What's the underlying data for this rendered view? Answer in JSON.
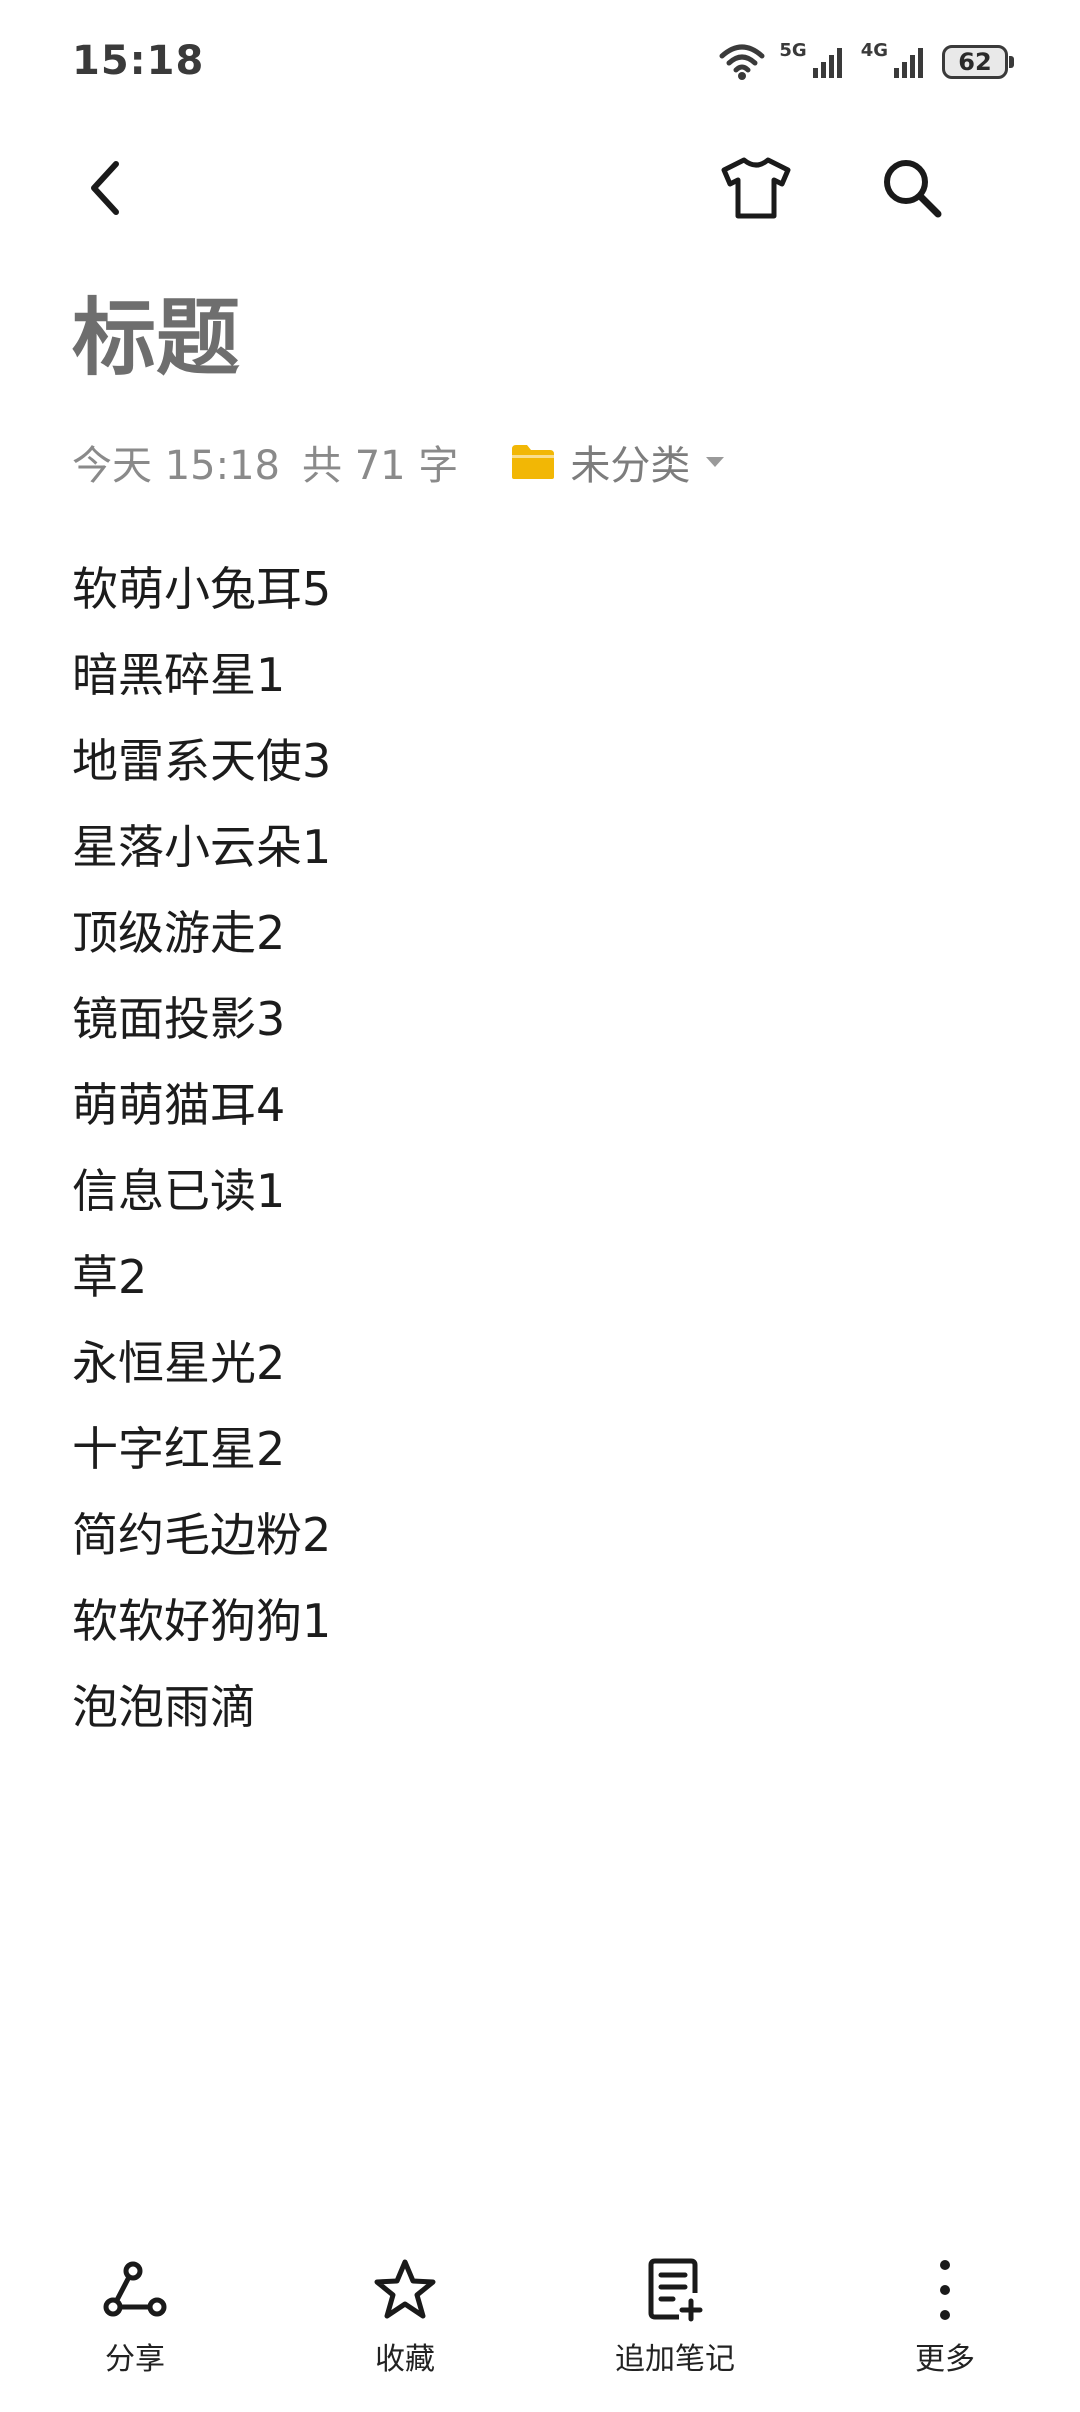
{
  "status_bar": {
    "time": "15:18",
    "net1": "5G",
    "net2": "4G",
    "battery": "62"
  },
  "icons": {
    "back": "chevron-left-icon",
    "theme": "shirt-icon",
    "search": "search-icon"
  },
  "note": {
    "title": "标题",
    "date": "今天 15:18",
    "word_count": "共 71 字",
    "folder": "未分类",
    "folder_color": "#F2B705",
    "lines": [
      "软萌小兔耳5",
      "暗黑碎星1",
      "地雷系天使3",
      "星落小云朵1",
      "顶级游走2",
      "镜面投影3",
      "萌萌猫耳4",
      "信息已读1",
      "草2",
      "永恒星光2",
      "十字红星2",
      "简约毛边粉2",
      "软软好狗狗1",
      "泡泡雨滴"
    ]
  },
  "toolbar": {
    "share": "分享",
    "favorite": "收藏",
    "append_note": "追加笔记",
    "more": "更多"
  }
}
